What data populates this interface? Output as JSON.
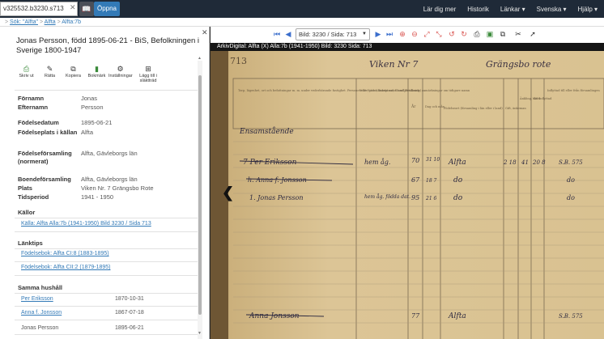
{
  "topbar": {
    "search_value": "v325532.b3230.s713",
    "clear_symbol": "✕",
    "book_symbol": "📖",
    "open_label": "Öppna",
    "nav": [
      "Lär dig mer",
      "Historik",
      "Länkar ▾",
      "Svenska ▾",
      "Hjälp ▾"
    ]
  },
  "breadcrumb": {
    "items": [
      "Sök: \"Alfta\"",
      "Alfta",
      "Alfta:7b"
    ],
    "separator": ">"
  },
  "toolbar": {
    "image_select": "Bild: 3230 / Sida: 713",
    "icons_left": [
      "⏮",
      "◀"
    ],
    "icons_right": [
      "▶",
      "⏭",
      "⊕",
      "⊖",
      "⤢",
      "⤡",
      "↺",
      "↻",
      "⎙",
      "▣",
      "⧉",
      "✂",
      "➚"
    ]
  },
  "panel": {
    "close": "✕",
    "title": "Jonas Persson, född 1895-06-21 - BiS, Befolkningen i Sverige 1800-1947",
    "actions": [
      {
        "icon": "⎙",
        "label": "Skriv ut"
      },
      {
        "icon": "✎",
        "label": "Rätta"
      },
      {
        "icon": "⧉",
        "label": "Kopiera"
      },
      {
        "icon": "▮",
        "label": "Bokmärk"
      },
      {
        "icon": "⚙",
        "label": "Inställningar"
      },
      {
        "icon": "⊞",
        "label": "Lägg till i släktträd"
      }
    ],
    "fields": [
      {
        "label": "Förnamn",
        "value": "Jonas"
      },
      {
        "label": "Efternamn",
        "value": "Persson"
      },
      {
        "label": "Födelsedatum",
        "value": "1895-06-21"
      },
      {
        "label": "Födelseplats i källan",
        "value": "Alfta"
      },
      {
        "label": "Födelseförsamling (normerat)",
        "value": "Alfta, Gävleborgs län"
      },
      {
        "label": "Boendeförsamling",
        "value": "Alfta, Gävleborgs län"
      },
      {
        "label": "Plats",
        "value": "Viken Nr. 7 Grängsbo Rote"
      },
      {
        "label": "Tidsperiod",
        "value": "1941 - 1950"
      }
    ],
    "sources_title": "Källor",
    "source_link": "Källa: Alfta Alla:7b (1941-1950) Bild 3230 / Sida 713",
    "tips_title": "Länktips",
    "tips": [
      "Födelsebok: Alfta CI:8 (1883-1895)",
      "Födelsebok: Alfta CII:2 (1879-1895)"
    ],
    "household_title": "Samma hushåll",
    "household": [
      {
        "name": "Per Eriksson",
        "date": "1870-10-31",
        "link": true
      },
      {
        "name": "Anna f. Jonsson",
        "date": "1867-07-18",
        "link": true
      },
      {
        "name": "Jonas Persson",
        "date": "1895-06-21",
        "link": false
      },
      {
        "name": "",
        "date": "1895-06-21",
        "link": false
      }
    ]
  },
  "viewer": {
    "caption": "ArkivDigital: Alfta (X) Alla:7b (1941-1950) Bild: 3230 Sida: 713",
    "page_number": "713",
    "heading_left": "Viken Nr 7",
    "heading_right": "Grängsbo rote",
    "column_headers": [
      "Torp, lägenhet, ort och befattningar m. m. under vederbörande fastighet. Personens för- och tillnamn samt familjeställning, anmärkningar om tidigare namn",
      "Yrke (tjänst, sidotjänst) Stand (Brukande) ...",
      "År",
      "Dag och mån.",
      "Födelseort (församling i län eller i land)",
      "Gift, änkeman",
      "Änkling, skild",
      "När inflyttad",
      "Inflyttad till eller från församlingen"
    ],
    "entries": [
      {
        "text": "Ensamstående",
        "occupation": "",
        "year": "",
        "date": "",
        "place": ""
      },
      {
        "text": "7 Per Eriksson",
        "occupation": "hem åg.",
        "year": "70",
        "date": "31 10",
        "place": "Alfta"
      },
      {
        "text": "h. Anna f. Jonsson",
        "occupation": "",
        "year": "67",
        "date": "18 7",
        "place": "do"
      },
      {
        "text": "1. Jonas Persson",
        "occupation": "hem åg. födda dat.",
        "year": "95",
        "date": "21 6",
        "place": "do"
      },
      {
        "text": "Anna Jonsson",
        "occupation": "",
        "year": "77",
        "date": "",
        "place": "Alfta"
      }
    ],
    "margin_marks": [
      "2 18",
      "41",
      "20 8"
    ],
    "right_notes": [
      "S.B. 575",
      "do",
      "do",
      "S.B. 575"
    ]
  }
}
